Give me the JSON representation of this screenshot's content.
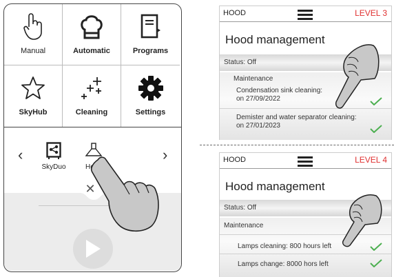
{
  "home": {
    "tiles": [
      {
        "label": "Manual",
        "icon": "hand-pointer-icon"
      },
      {
        "label": "Automatic",
        "icon": "chef-hat-icon"
      },
      {
        "label": "Programs",
        "icon": "book-icon"
      },
      {
        "label": "SkyHub",
        "icon": "star-icon"
      },
      {
        "label": "Cleaning",
        "icon": "sparkles-icon"
      },
      {
        "label": "Settings",
        "icon": "gear-icon"
      }
    ],
    "carousel": {
      "prev": "‹",
      "next": "›",
      "items": [
        {
          "label": "SkyDuo",
          "icon": "skyduo-icon"
        },
        {
          "label": "Hood",
          "icon": "hood-icon"
        }
      ]
    },
    "close": "✕"
  },
  "panel_level3": {
    "header": "HOOD",
    "level": "LEVEL 3",
    "title": "Hood management",
    "status": "Status: Off",
    "maintenance": "Maintenance",
    "item1_line1": "Condensation sink cleaning:",
    "item1_line2": "on 27/09/2022",
    "item2_line1": "Demister and water separator cleaning:",
    "item2_line2": "on 27/01/2023"
  },
  "panel_level4": {
    "header": "HOOD",
    "level": "LEVEL 4",
    "title": "Hood management",
    "status": "Status: Off",
    "maintenance": "Maintenance",
    "item1": "Lamps cleaning: 800 hours left",
    "item2": "Lamps change: 8000 hors left"
  },
  "colors": {
    "level": "#e03030",
    "check": "#4caf50"
  }
}
